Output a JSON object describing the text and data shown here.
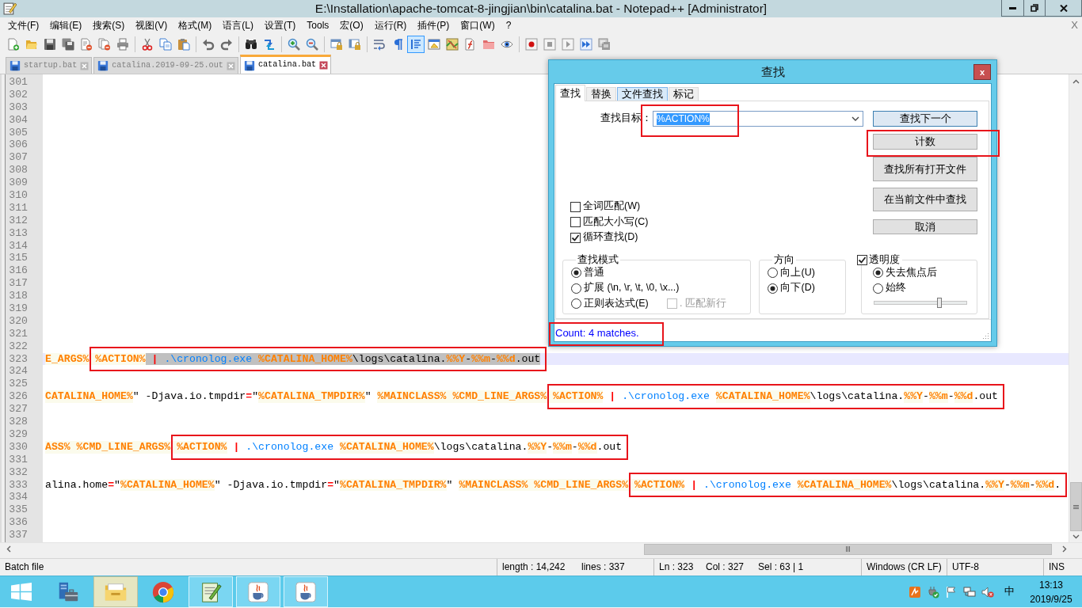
{
  "window": {
    "title": "E:\\Installation\\apache-tomcat-8-jingjian\\bin\\catalina.bat - Notepad++ [Administrator]"
  },
  "menu": {
    "items": [
      "文件(F)",
      "编辑(E)",
      "搜索(S)",
      "视图(V)",
      "格式(M)",
      "语言(L)",
      "设置(T)",
      "Tools",
      "宏(O)",
      "运行(R)",
      "插件(P)",
      "窗口(W)",
      "?"
    ],
    "close_label": "X"
  },
  "toolbar": [
    {
      "kind": "new",
      "pressed": false
    },
    {
      "kind": "open",
      "pressed": false
    },
    {
      "kind": "save",
      "pressed": false
    },
    {
      "kind": "saveall",
      "pressed": false
    },
    {
      "kind": "close",
      "pressed": false
    },
    {
      "kind": "closeall",
      "pressed": false
    },
    {
      "kind": "print",
      "pressed": false
    },
    {
      "kind": "separator"
    },
    {
      "kind": "cut",
      "pressed": false
    },
    {
      "kind": "copy",
      "pressed": false
    },
    {
      "kind": "paste",
      "pressed": false
    },
    {
      "kind": "separator"
    },
    {
      "kind": "undo",
      "pressed": false
    },
    {
      "kind": "redo",
      "pressed": false
    },
    {
      "kind": "separator"
    },
    {
      "kind": "find",
      "pressed": false
    },
    {
      "kind": "replace",
      "pressed": false
    },
    {
      "kind": "separator"
    },
    {
      "kind": "zoomin",
      "pressed": false
    },
    {
      "kind": "zoomout",
      "pressed": false
    },
    {
      "kind": "separator"
    },
    {
      "kind": "syncv",
      "pressed": false
    },
    {
      "kind": "synch",
      "pressed": false
    },
    {
      "kind": "separator"
    },
    {
      "kind": "wrap",
      "pressed": false
    },
    {
      "kind": "allchars",
      "pressed": false
    },
    {
      "kind": "indent",
      "pressed": true
    },
    {
      "kind": "udl",
      "pressed": false
    },
    {
      "kind": "docmap",
      "pressed": false
    },
    {
      "kind": "funclist",
      "pressed": false
    },
    {
      "kind": "folder",
      "pressed": false
    },
    {
      "kind": "monitor",
      "pressed": false
    },
    {
      "kind": "separator"
    },
    {
      "kind": "record",
      "pressed": false
    },
    {
      "kind": "stop",
      "pressed": false
    },
    {
      "kind": "play",
      "pressed": false
    },
    {
      "kind": "playmulti",
      "pressed": false
    },
    {
      "kind": "savemacro",
      "pressed": false
    }
  ],
  "tabs": [
    {
      "label": "startup.bat",
      "selected": false
    },
    {
      "label": "catalina.2019-09-25.out",
      "selected": false
    },
    {
      "label": "catalina.bat",
      "selected": true
    }
  ],
  "editor": {
    "lines": [
      {
        "number": "301",
        "current": false
      },
      {
        "number": "302",
        "current": false
      },
      {
        "number": "303",
        "current": false
      },
      {
        "number": "304",
        "current": false
      },
      {
        "number": "305",
        "current": false
      },
      {
        "number": "306",
        "current": false
      },
      {
        "number": "307",
        "current": false
      },
      {
        "number": "308",
        "current": false
      },
      {
        "number": "309",
        "current": false
      },
      {
        "number": "310",
        "current": false
      },
      {
        "number": "311",
        "current": false
      },
      {
        "number": "312",
        "current": false
      },
      {
        "number": "313",
        "current": false
      },
      {
        "number": "314",
        "current": false
      },
      {
        "number": "315",
        "current": false
      },
      {
        "number": "316",
        "current": false
      },
      {
        "number": "317",
        "current": false
      },
      {
        "number": "318",
        "current": false
      },
      {
        "number": "319",
        "current": false
      },
      {
        "number": "320",
        "current": false
      },
      {
        "number": "321",
        "current": false
      },
      {
        "number": "322",
        "current": false
      },
      {
        "number": "323",
        "current": true,
        "runs": [
          {
            "highlighted": false,
            "tokens": [
              {
                "text": "E_ARGS% ",
                "kind": "variable",
                "selected": false
              }
            ]
          },
          {
            "highlighted": true,
            "tokens": [
              {
                "text": "%ACTION%",
                "kind": "variable",
                "selected": false
              },
              {
                "text": " | ",
                "kind": "operator",
                "selected": true
              },
              {
                "text": ".\\cronolog.exe ",
                "kind": "command",
                "selected": true
              },
              {
                "text": "%CATALINA_HOME%",
                "kind": "variable",
                "selected": true
              },
              {
                "text": "\\logs\\catalina.",
                "kind": "text",
                "selected": true
              },
              {
                "text": "%%Y",
                "kind": "variable",
                "selected": true
              },
              {
                "text": "-",
                "kind": "text",
                "selected": true
              },
              {
                "text": "%%m",
                "kind": "variable",
                "selected": true
              },
              {
                "text": "-",
                "kind": "text",
                "selected": true
              },
              {
                "text": "%%d",
                "kind": "variable",
                "selected": true
              },
              {
                "text": ".out",
                "kind": "text",
                "selected": true
              }
            ]
          }
        ]
      },
      {
        "number": "324",
        "current": false
      },
      {
        "number": "325",
        "current": false
      },
      {
        "number": "326",
        "current": false,
        "runs": [
          {
            "highlighted": false,
            "tokens": [
              {
                "text": "CATALINA_HOME%",
                "kind": "variable"
              },
              {
                "text": "\" -Djava.io.tmpdir",
                "kind": "text"
              },
              {
                "text": "=",
                "kind": "operator"
              },
              {
                "text": "\"",
                "kind": "text"
              },
              {
                "text": "%CATALINA_TMPDIR%",
                "kind": "variable"
              },
              {
                "text": "\" ",
                "kind": "text"
              },
              {
                "text": "%MAINCLASS% ",
                "kind": "variable"
              },
              {
                "text": "%CMD_LINE_ARGS% ",
                "kind": "variable"
              }
            ]
          },
          {
            "highlighted": true,
            "tokens": [
              {
                "text": "%ACTION%",
                "kind": "variable"
              },
              {
                "text": " | ",
                "kind": "operator"
              },
              {
                "text": ".\\cronolog.exe ",
                "kind": "command"
              },
              {
                "text": "%CATALINA_HOME%",
                "kind": "variable"
              },
              {
                "text": "\\logs\\catalina.",
                "kind": "text"
              },
              {
                "text": "%%Y",
                "kind": "variable"
              },
              {
                "text": "-",
                "kind": "text"
              },
              {
                "text": "%%m",
                "kind": "variable"
              },
              {
                "text": "-",
                "kind": "text"
              },
              {
                "text": "%%d",
                "kind": "variable"
              },
              {
                "text": ".out",
                "kind": "text"
              }
            ]
          }
        ]
      },
      {
        "number": "327",
        "current": false
      },
      {
        "number": "328",
        "current": false
      },
      {
        "number": "329",
        "current": false
      },
      {
        "number": "330",
        "current": false,
        "runs": [
          {
            "highlighted": false,
            "tokens": [
              {
                "text": "ASS% ",
                "kind": "variable"
              },
              {
                "text": "%CMD_LINE_ARGS% ",
                "kind": "variable"
              }
            ]
          },
          {
            "highlighted": true,
            "tokens": [
              {
                "text": "%ACTION%",
                "kind": "variable"
              },
              {
                "text": " | ",
                "kind": "operator"
              },
              {
                "text": ".\\cronolog.exe ",
                "kind": "command"
              },
              {
                "text": "%CATALINA_HOME%",
                "kind": "variable"
              },
              {
                "text": "\\logs\\catalina.",
                "kind": "text"
              },
              {
                "text": "%%Y",
                "kind": "variable"
              },
              {
                "text": "-",
                "kind": "text"
              },
              {
                "text": "%%m",
                "kind": "variable"
              },
              {
                "text": "-",
                "kind": "text"
              },
              {
                "text": "%%d",
                "kind": "variable"
              },
              {
                "text": ".out",
                "kind": "text"
              }
            ]
          }
        ]
      },
      {
        "number": "331",
        "current": false
      },
      {
        "number": "332",
        "current": false
      },
      {
        "number": "333",
        "current": false,
        "runs": [
          {
            "highlighted": false,
            "tokens": [
              {
                "text": "alina.home",
                "kind": "text"
              },
              {
                "text": "=",
                "kind": "operator"
              },
              {
                "text": "\"",
                "kind": "text"
              },
              {
                "text": "%CATALINA_HOME%",
                "kind": "variable"
              },
              {
                "text": "\" -Djava.io.tmpdir",
                "kind": "text"
              },
              {
                "text": "=",
                "kind": "operator"
              },
              {
                "text": "\"",
                "kind": "text"
              },
              {
                "text": "%CATALINA_TMPDIR%",
                "kind": "variable"
              },
              {
                "text": "\" ",
                "kind": "text"
              },
              {
                "text": "%MAINCLASS% ",
                "kind": "variable"
              },
              {
                "text": "%CMD_LINE_ARGS% ",
                "kind": "variable"
              }
            ]
          },
          {
            "highlighted": true,
            "tokens": [
              {
                "text": "%ACTION%",
                "kind": "variable"
              },
              {
                "text": " | ",
                "kind": "operator"
              },
              {
                "text": ".\\cronolog.exe ",
                "kind": "command"
              },
              {
                "text": "%CATALINA_HOME%",
                "kind": "variable"
              },
              {
                "text": "\\logs\\catalina.",
                "kind": "text"
              },
              {
                "text": "%%Y",
                "kind": "variable"
              },
              {
                "text": "-",
                "kind": "text"
              },
              {
                "text": "%%m",
                "kind": "variable"
              },
              {
                "text": "-",
                "kind": "text"
              },
              {
                "text": "%%d",
                "kind": "variable"
              },
              {
                "text": ".",
                "kind": "text"
              }
            ]
          }
        ]
      },
      {
        "number": "334",
        "current": false
      },
      {
        "number": "335",
        "current": false
      },
      {
        "number": "336",
        "current": false
      },
      {
        "number": "337",
        "current": false
      }
    ]
  },
  "status_bar": {
    "file_type": "Batch file",
    "doc_info": [
      "length : 14,242",
      "lines : 337"
    ],
    "position": [
      "Ln : 323",
      "Col : 327",
      "Sel : 63 | 1"
    ],
    "eol": "Windows (CR LF)",
    "encoding": "UTF-8",
    "mode": "INS"
  },
  "find_dialog": {
    "title": "查找",
    "close_label": "x",
    "tabs": [
      {
        "label": "查找",
        "selected": true,
        "hovered": false
      },
      {
        "label": "替换",
        "selected": false,
        "hovered": false
      },
      {
        "label": "文件查找",
        "selected": false,
        "hovered": true
      },
      {
        "label": "标记",
        "selected": false,
        "hovered": false
      }
    ],
    "search": {
      "label": "查找目标：",
      "value": "%ACTION%",
      "value_selected": true,
      "highlighted": true
    },
    "buttons": [
      {
        "label": "查找下一个",
        "default": true,
        "highlighted": false
      },
      {
        "label": "计数",
        "default": false,
        "highlighted": true
      },
      {
        "label": "查找所有打开文件",
        "default": false,
        "highlighted": false
      },
      {
        "label": "在当前文件中查找",
        "default": false,
        "highlighted": false
      },
      {
        "label": "取消",
        "default": false,
        "highlighted": false
      }
    ],
    "options": [
      {
        "label": "全词匹配(W)",
        "checked": false
      },
      {
        "label": "匹配大小写(C)",
        "checked": false
      },
      {
        "label": "循环查找(D)",
        "checked": true
      }
    ],
    "search_mode": {
      "title": "查找模式",
      "options": [
        {
          "label": "普通",
          "selected": true
        },
        {
          "label": "扩展 (\\n, \\r, \\t, \\0, \\x...)",
          "selected": false
        },
        {
          "label": "正则表达式(E)",
          "selected": false
        }
      ],
      "dot_newline": {
        "label": ". 匹配新行",
        "checked": false,
        "disabled": true
      }
    },
    "direction": {
      "title": "方向",
      "options": [
        {
          "label": "向上(U)",
          "selected": false
        },
        {
          "label": "向下(D)",
          "selected": true
        }
      ]
    },
    "transparency": {
      "title": "透明度",
      "checked": true,
      "options": [
        {
          "label": "失去焦点后",
          "selected": true
        },
        {
          "label": "始终",
          "selected": false
        }
      ],
      "level": 0.72
    },
    "status": {
      "text": "Count: 4 matches.",
      "highlighted": true
    }
  },
  "taskbar": {
    "apps": [
      {
        "kind": "server",
        "running": false,
        "hovered": false
      },
      {
        "kind": "explorer",
        "running": false,
        "hovered": true
      },
      {
        "kind": "browser",
        "running": false,
        "hovered": false
      },
      {
        "kind": "notepad",
        "running": true,
        "hovered": false
      },
      {
        "kind": "java",
        "running": true,
        "hovered": false
      },
      {
        "kind": "java",
        "running": true,
        "hovered": false
      }
    ],
    "tray": {
      "ime": "中",
      "time": "13:13",
      "date": "2019/9/25"
    }
  }
}
